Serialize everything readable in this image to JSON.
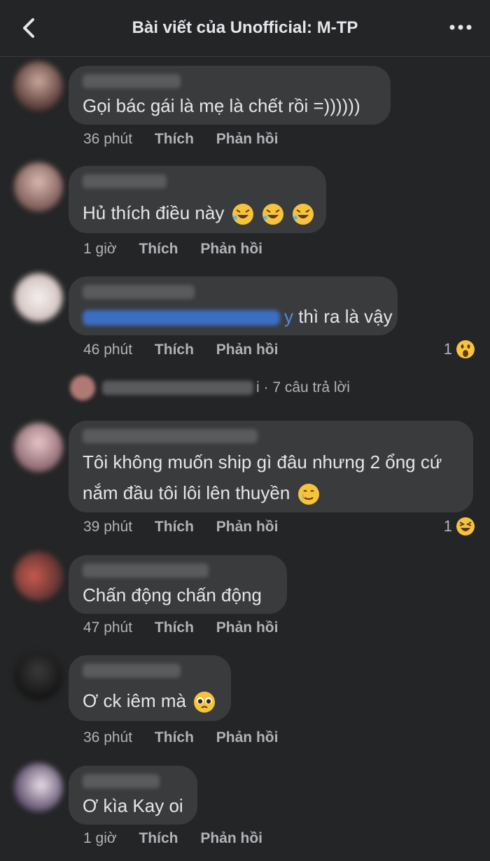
{
  "header": {
    "title": "Bài viết của Unofficial: M-TP"
  },
  "comments": [
    {
      "text": "Gọi bác gái là mẹ là chết rồi =))))))",
      "time": "36 phút",
      "like": "Thích",
      "reply": "Phản hồi"
    },
    {
      "text": "Hủ thích điều này",
      "time": "1 giờ",
      "like": "Thích",
      "reply": "Phản hồi",
      "emoji": "rofl-emoji"
    },
    {
      "text_after_mention": "y",
      "text": "thì ra là vậy",
      "time": "46 phút",
      "like": "Thích",
      "reply": "Phản hồi",
      "reaction_count": "1",
      "reaction": "wow-emoji"
    },
    {
      "text_line1": "Tôi không muốn ship gì đâu nhưng 2 ổng cứ",
      "text_line2": "nắm đầu tôi lôi lên thuyền",
      "time": "39 phút",
      "like": "Thích",
      "reply": "Phản hồi",
      "reaction_count": "1",
      "reaction": "haha-emoji",
      "emoji": "crying-smile-emoji"
    },
    {
      "text": "Chấn động chấn động",
      "time": "47 phút",
      "like": "Thích",
      "reply": "Phản hồi"
    },
    {
      "text": "Ơ ck iêm mà",
      "time": "36 phút",
      "like": "Thích",
      "reply": "Phản hồi",
      "emoji": "pleading-emoji"
    },
    {
      "text": "Ơ kìa Kay oi",
      "time": "1 giờ",
      "like": "Thích",
      "reply": "Phản hồi"
    }
  ],
  "replies": {
    "text": "i · 7 câu trả lời"
  }
}
